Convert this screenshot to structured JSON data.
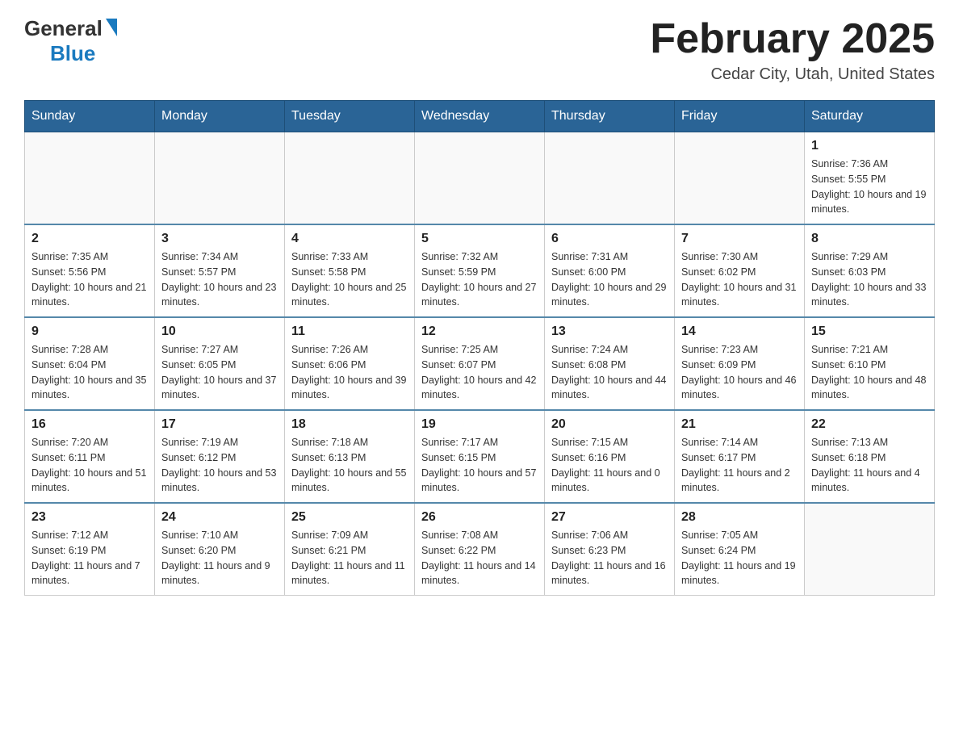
{
  "header": {
    "logo_general": "General",
    "logo_blue": "Blue",
    "month_title": "February 2025",
    "location": "Cedar City, Utah, United States"
  },
  "days_of_week": [
    "Sunday",
    "Monday",
    "Tuesday",
    "Wednesday",
    "Thursday",
    "Friday",
    "Saturday"
  ],
  "weeks": [
    [
      {
        "day": "",
        "info": ""
      },
      {
        "day": "",
        "info": ""
      },
      {
        "day": "",
        "info": ""
      },
      {
        "day": "",
        "info": ""
      },
      {
        "day": "",
        "info": ""
      },
      {
        "day": "",
        "info": ""
      },
      {
        "day": "1",
        "info": "Sunrise: 7:36 AM\nSunset: 5:55 PM\nDaylight: 10 hours and 19 minutes."
      }
    ],
    [
      {
        "day": "2",
        "info": "Sunrise: 7:35 AM\nSunset: 5:56 PM\nDaylight: 10 hours and 21 minutes."
      },
      {
        "day": "3",
        "info": "Sunrise: 7:34 AM\nSunset: 5:57 PM\nDaylight: 10 hours and 23 minutes."
      },
      {
        "day": "4",
        "info": "Sunrise: 7:33 AM\nSunset: 5:58 PM\nDaylight: 10 hours and 25 minutes."
      },
      {
        "day": "5",
        "info": "Sunrise: 7:32 AM\nSunset: 5:59 PM\nDaylight: 10 hours and 27 minutes."
      },
      {
        "day": "6",
        "info": "Sunrise: 7:31 AM\nSunset: 6:00 PM\nDaylight: 10 hours and 29 minutes."
      },
      {
        "day": "7",
        "info": "Sunrise: 7:30 AM\nSunset: 6:02 PM\nDaylight: 10 hours and 31 minutes."
      },
      {
        "day": "8",
        "info": "Sunrise: 7:29 AM\nSunset: 6:03 PM\nDaylight: 10 hours and 33 minutes."
      }
    ],
    [
      {
        "day": "9",
        "info": "Sunrise: 7:28 AM\nSunset: 6:04 PM\nDaylight: 10 hours and 35 minutes."
      },
      {
        "day": "10",
        "info": "Sunrise: 7:27 AM\nSunset: 6:05 PM\nDaylight: 10 hours and 37 minutes."
      },
      {
        "day": "11",
        "info": "Sunrise: 7:26 AM\nSunset: 6:06 PM\nDaylight: 10 hours and 39 minutes."
      },
      {
        "day": "12",
        "info": "Sunrise: 7:25 AM\nSunset: 6:07 PM\nDaylight: 10 hours and 42 minutes."
      },
      {
        "day": "13",
        "info": "Sunrise: 7:24 AM\nSunset: 6:08 PM\nDaylight: 10 hours and 44 minutes."
      },
      {
        "day": "14",
        "info": "Sunrise: 7:23 AM\nSunset: 6:09 PM\nDaylight: 10 hours and 46 minutes."
      },
      {
        "day": "15",
        "info": "Sunrise: 7:21 AM\nSunset: 6:10 PM\nDaylight: 10 hours and 48 minutes."
      }
    ],
    [
      {
        "day": "16",
        "info": "Sunrise: 7:20 AM\nSunset: 6:11 PM\nDaylight: 10 hours and 51 minutes."
      },
      {
        "day": "17",
        "info": "Sunrise: 7:19 AM\nSunset: 6:12 PM\nDaylight: 10 hours and 53 minutes."
      },
      {
        "day": "18",
        "info": "Sunrise: 7:18 AM\nSunset: 6:13 PM\nDaylight: 10 hours and 55 minutes."
      },
      {
        "day": "19",
        "info": "Sunrise: 7:17 AM\nSunset: 6:15 PM\nDaylight: 10 hours and 57 minutes."
      },
      {
        "day": "20",
        "info": "Sunrise: 7:15 AM\nSunset: 6:16 PM\nDaylight: 11 hours and 0 minutes."
      },
      {
        "day": "21",
        "info": "Sunrise: 7:14 AM\nSunset: 6:17 PM\nDaylight: 11 hours and 2 minutes."
      },
      {
        "day": "22",
        "info": "Sunrise: 7:13 AM\nSunset: 6:18 PM\nDaylight: 11 hours and 4 minutes."
      }
    ],
    [
      {
        "day": "23",
        "info": "Sunrise: 7:12 AM\nSunset: 6:19 PM\nDaylight: 11 hours and 7 minutes."
      },
      {
        "day": "24",
        "info": "Sunrise: 7:10 AM\nSunset: 6:20 PM\nDaylight: 11 hours and 9 minutes."
      },
      {
        "day": "25",
        "info": "Sunrise: 7:09 AM\nSunset: 6:21 PM\nDaylight: 11 hours and 11 minutes."
      },
      {
        "day": "26",
        "info": "Sunrise: 7:08 AM\nSunset: 6:22 PM\nDaylight: 11 hours and 14 minutes."
      },
      {
        "day": "27",
        "info": "Sunrise: 7:06 AM\nSunset: 6:23 PM\nDaylight: 11 hours and 16 minutes."
      },
      {
        "day": "28",
        "info": "Sunrise: 7:05 AM\nSunset: 6:24 PM\nDaylight: 11 hours and 19 minutes."
      },
      {
        "day": "",
        "info": ""
      }
    ]
  ]
}
